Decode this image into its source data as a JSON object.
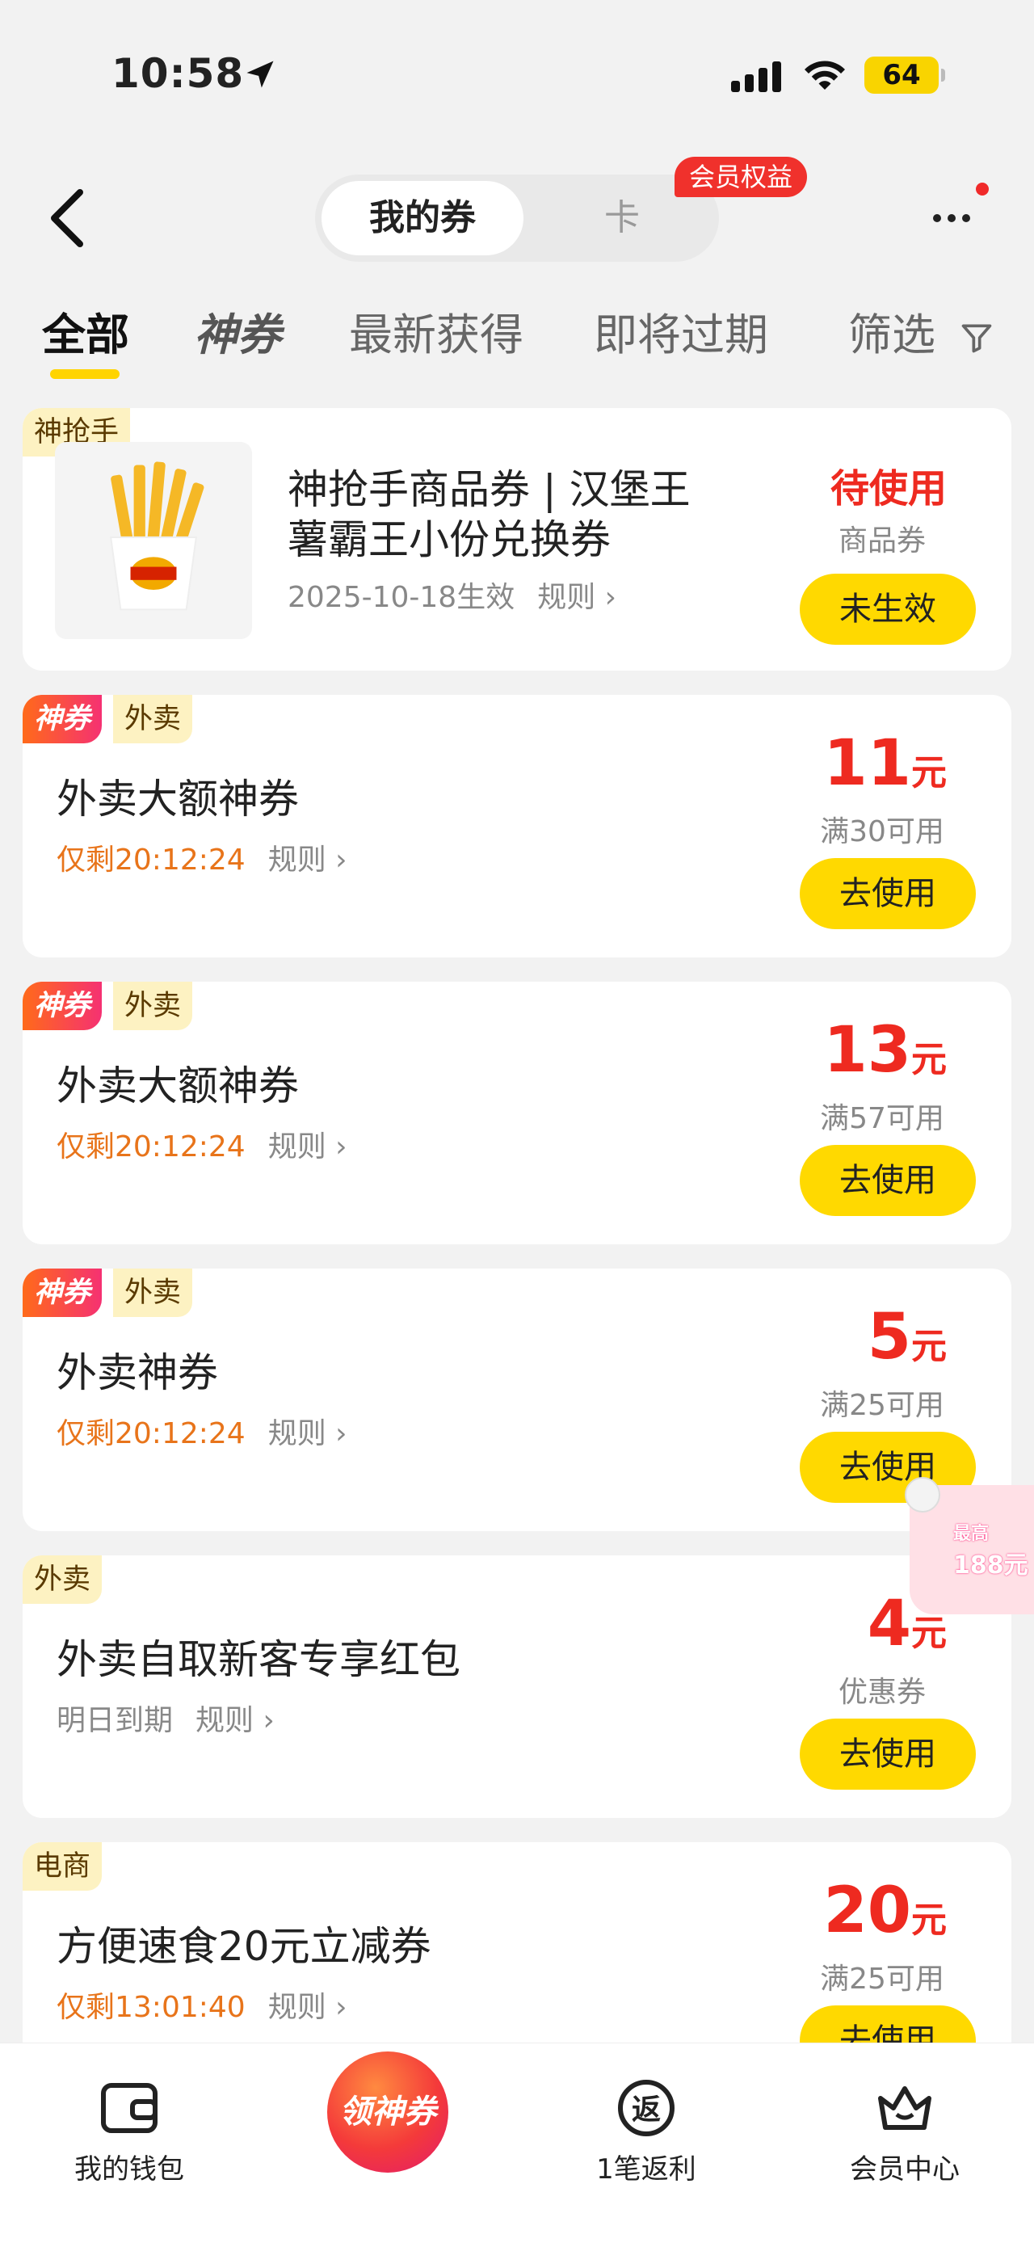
{
  "status_bar": {
    "time": "10:58",
    "battery": "64"
  },
  "header": {
    "tab_coupons": "我的券",
    "tab_cards": "卡",
    "member_badge": "会员权益"
  },
  "filter_tabs": [
    {
      "label": "全部",
      "active": true
    },
    {
      "label": "神券",
      "active": false
    },
    {
      "label": "最新获得",
      "active": false
    },
    {
      "label": "即将过期",
      "active": false
    },
    {
      "label": "筛选",
      "active": false
    }
  ],
  "cards": [
    {
      "tags": [
        "神抢手"
      ],
      "title_line1": "神抢手商品券 | 汉堡王",
      "title_line2": "薯霸王小份兑换券",
      "sub": "2025-10-18生效",
      "rule": "规则",
      "status": "待使用",
      "type": "商品券",
      "button": "未生效"
    },
    {
      "tags": [
        "神券",
        "外卖"
      ],
      "title": "外卖大额神券",
      "sub": "仅剩20:12:24",
      "rule": "规则",
      "amount": "11",
      "unit": "元",
      "cond": "满30可用",
      "button": "去使用"
    },
    {
      "tags": [
        "神券",
        "外卖"
      ],
      "title": "外卖大额神券",
      "sub": "仅剩20:12:24",
      "rule": "规则",
      "amount": "13",
      "unit": "元",
      "cond": "满57可用",
      "button": "去使用"
    },
    {
      "tags": [
        "神券",
        "外卖"
      ],
      "title": "外卖神券",
      "sub": "仅剩20:12:24",
      "rule": "规则",
      "amount": "5",
      "unit": "元",
      "cond": "满25可用",
      "button": "去使用"
    },
    {
      "tags": [
        "外卖"
      ],
      "title": "外卖自取新客专享红包",
      "sub": "明日到期",
      "rule": "规则",
      "amount": "4",
      "unit": "元",
      "cond": "优惠券",
      "button": "去使用"
    },
    {
      "tags": [
        "电商"
      ],
      "title": "方便速食20元立减券",
      "sub": "仅剩13:01:40",
      "rule": "规则",
      "amount": "20",
      "unit": "元",
      "cond": "满25可用",
      "button": "去使用"
    }
  ],
  "floating_widget": {
    "label": "最高",
    "value": "188元"
  },
  "bottom_nav": {
    "wallet": "我的钱包",
    "center": "领神券",
    "cashback": "1笔返利",
    "member": "会员中心",
    "cashback_icon_char": "返"
  },
  "colors": {
    "accent_yellow": "#ffd900",
    "price_red": "#ee2a20",
    "countdown_orange": "#e8741a"
  }
}
